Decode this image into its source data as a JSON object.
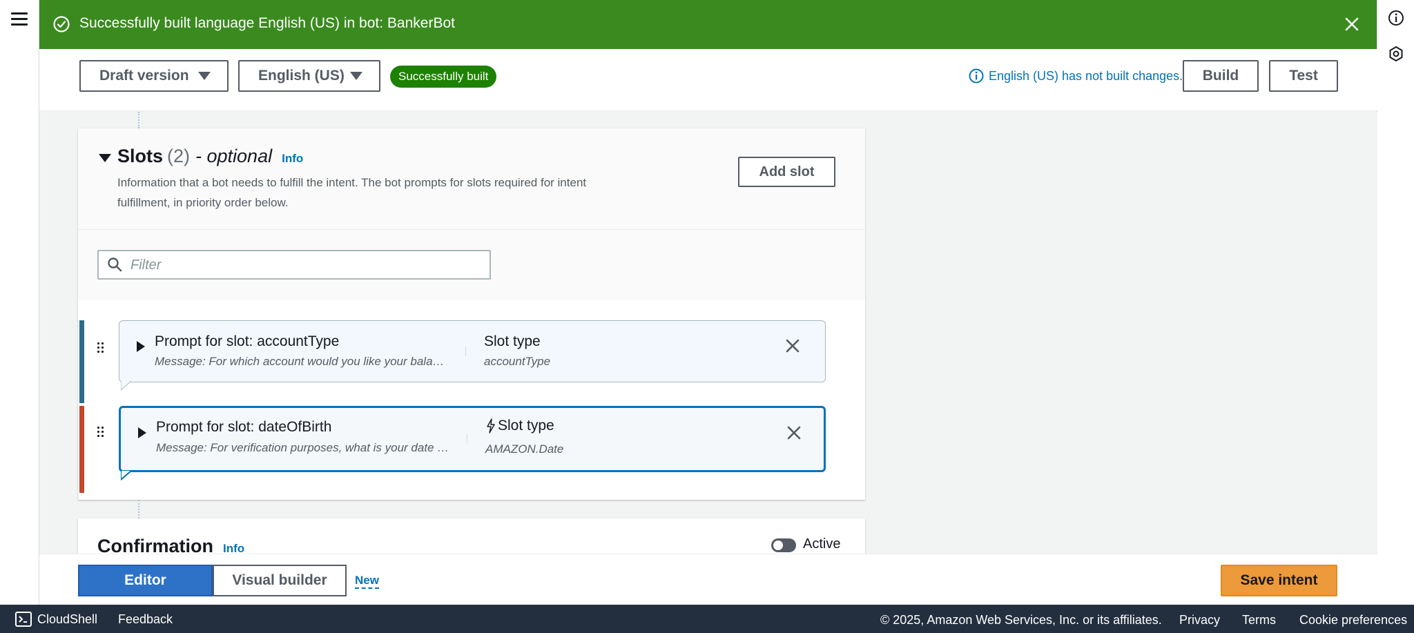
{
  "flash": {
    "message": "Successfully built language English (US) in bot: BankerBot"
  },
  "topbar": {
    "version_label": "Draft version",
    "language_label": "English (US)",
    "status_badge": "Successfully built",
    "build_status": "English (US) has not built changes.",
    "build_label": "Build",
    "test_label": "Test"
  },
  "slots": {
    "title": "Slots",
    "count": "(2)",
    "optional": "- optional",
    "info_label": "Info",
    "description": "Information that a bot needs to fulfill the intent. The bot prompts for slots required for intent fulfillment, in priority order below.",
    "add_slot_label": "Add slot",
    "filter_placeholder": "Filter",
    "items": [
      {
        "prompt": "Prompt for slot: accountType",
        "message": "Message: For which account would you like your balance?",
        "slot_type_label": "Slot type",
        "slot_type_value": "accountType",
        "bar_color": "#2e6b8a"
      },
      {
        "prompt": "Prompt for slot: dateOfBirth",
        "message": "Message: For verification purposes, what is your date of birth?",
        "slot_type_label": "Slot type",
        "slot_type_value": "AMAZON.Date",
        "bar_color": "#c4472a"
      }
    ]
  },
  "confirmation": {
    "title": "Confirmation",
    "info_label": "Info",
    "toggle_label": "Active"
  },
  "bottombar": {
    "editor_label": "Editor",
    "visual_builder_label": "Visual builder",
    "new_label": "New",
    "save_label": "Save intent"
  },
  "footer": {
    "cloudshell": "CloudShell",
    "feedback": "Feedback",
    "copyright": "© 2025, Amazon Web Services, Inc. or its affiliates.",
    "privacy": "Privacy",
    "terms": "Terms",
    "cookies": "Cookie preferences"
  },
  "colors": {
    "flash_bg": "#3a8a1f",
    "link": "#0073bb",
    "primary_segment": "#2e72c8",
    "save_button": "#ec9a3a",
    "footer_bg": "#232f3e"
  }
}
